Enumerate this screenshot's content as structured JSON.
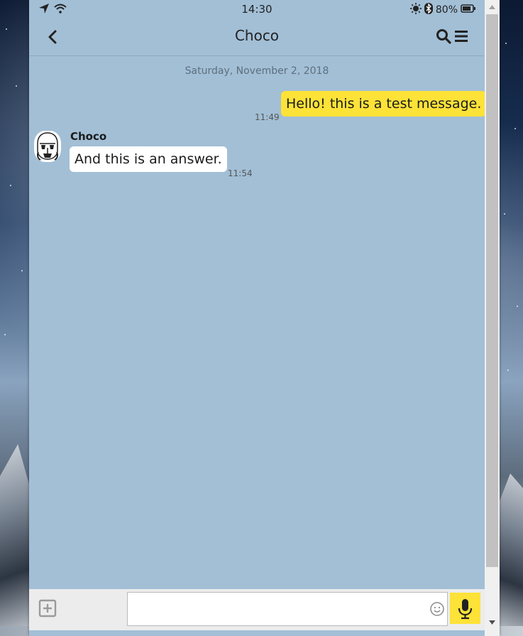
{
  "status_bar": {
    "time": "14:30",
    "battery": "80%",
    "icons": [
      "location-arrow-icon",
      "wifi-icon",
      "brightness-icon",
      "bluetooth-icon",
      "battery-icon"
    ]
  },
  "header": {
    "title": "Choco",
    "back_icon": "chevron-left-icon",
    "search_icon": "search-icon",
    "menu_icon": "hamburger-menu-icon"
  },
  "conversation": {
    "date": "Saturday, November 2, 2018",
    "messages": [
      {
        "direction": "outgoing",
        "text": "Hello! this is a test message.",
        "time": "11:49"
      },
      {
        "direction": "incoming",
        "sender": "Choco",
        "text": "And this is an answer.",
        "time": "11:54"
      }
    ]
  },
  "composer": {
    "input_value": "",
    "attach_icon": "plus-square-icon",
    "emoji_icon": "smiley-icon",
    "mic_icon": "microphone-icon"
  },
  "colors": {
    "chat_background": "#a2bfd6",
    "outgoing_bubble": "#fde238",
    "incoming_bubble": "#ffffff",
    "mic_button": "#fde238"
  }
}
